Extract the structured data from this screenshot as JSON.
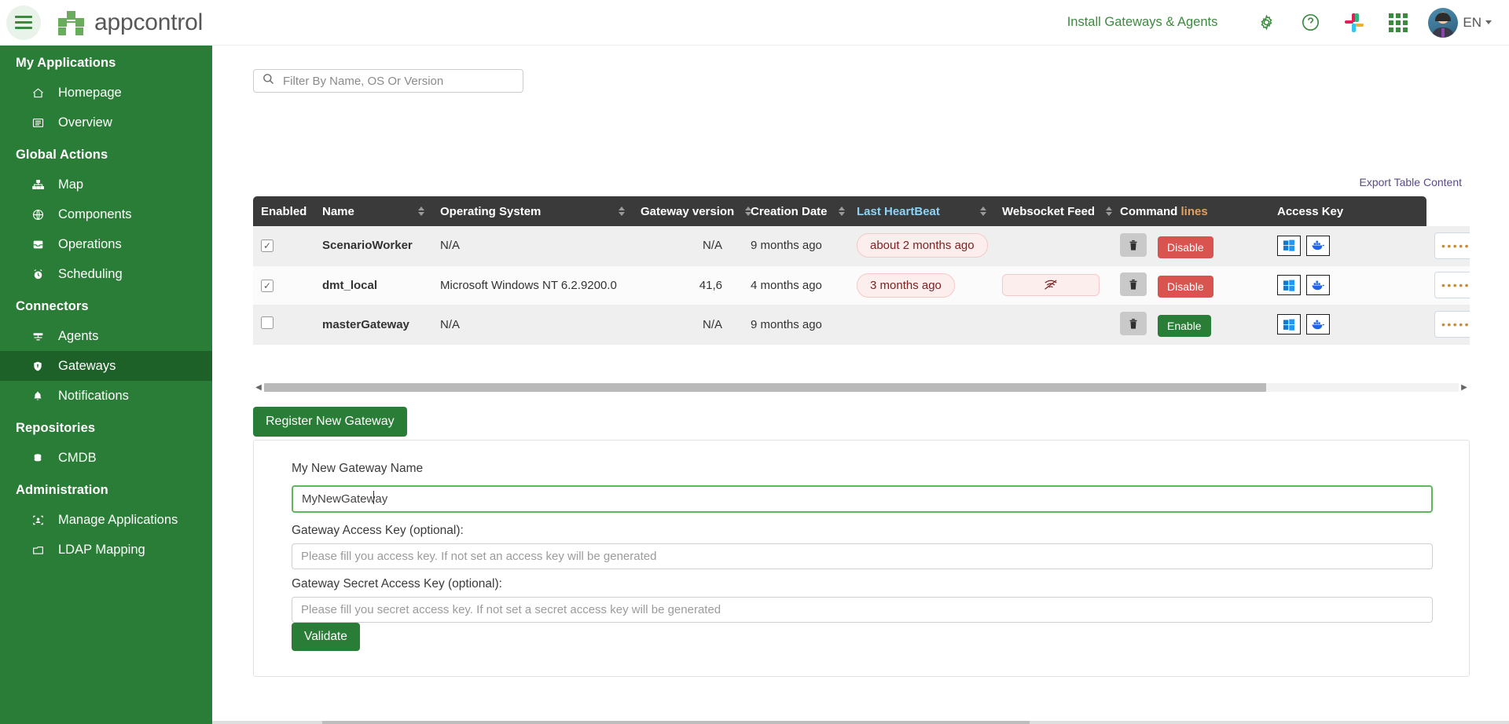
{
  "header": {
    "menu_icon": "hamburger-icon",
    "brand": "appcontrol",
    "install_link": "Install Gateways & Agents",
    "icons": [
      "gear-icon",
      "help-icon",
      "slack-icon",
      "apps-grid-icon"
    ],
    "language": "EN"
  },
  "sidebar": {
    "groups": [
      {
        "title": "My Applications",
        "items": [
          {
            "label": "Homepage",
            "icon": "home-icon",
            "active": false
          },
          {
            "label": "Overview",
            "icon": "list-icon",
            "active": false
          }
        ]
      },
      {
        "title": "Global Actions",
        "items": [
          {
            "label": "Map",
            "icon": "sitemap-icon",
            "active": false
          },
          {
            "label": "Components",
            "icon": "globe-icon",
            "active": false
          },
          {
            "label": "Operations",
            "icon": "tray-icon",
            "active": false
          },
          {
            "label": "Scheduling",
            "icon": "alarm-clock-icon",
            "active": false
          }
        ]
      },
      {
        "title": "Connectors",
        "items": [
          {
            "label": "Agents",
            "icon": "server-icon",
            "active": false
          },
          {
            "label": "Gateways",
            "icon": "shield-icon",
            "active": true
          },
          {
            "label": "Notifications",
            "icon": "bell-icon",
            "active": false
          }
        ]
      },
      {
        "title": "Repositories",
        "items": [
          {
            "label": "CMDB",
            "icon": "database-icon",
            "active": false
          }
        ]
      },
      {
        "title": "Administration",
        "items": [
          {
            "label": "Manage Applications",
            "icon": "user-card-icon",
            "active": false
          },
          {
            "label": "LDAP Mapping",
            "icon": "folder-icon",
            "active": false
          }
        ]
      }
    ]
  },
  "main": {
    "filter": {
      "placeholder": "Filter By Name, OS Or Version",
      "value": ""
    },
    "export_link": "Export Table Content",
    "table": {
      "columns": [
        {
          "label": "Enabled",
          "sortable": false,
          "active_sort": false
        },
        {
          "label": "Name",
          "sortable": true,
          "active_sort": false
        },
        {
          "label": "Operating System",
          "sortable": true,
          "active_sort": false
        },
        {
          "label": "Gateway version",
          "sortable": true,
          "active_sort": false
        },
        {
          "label": "Creation Date",
          "sortable": true,
          "active_sort": false
        },
        {
          "label": "Last HeartBeat",
          "sortable": true,
          "active_sort": true
        },
        {
          "label": "Websocket Feed",
          "sortable": true,
          "active_sort": false
        },
        {
          "label": "Command lines",
          "sortable": false,
          "active_sort": false
        },
        {
          "label": "Access Key",
          "sortable": false,
          "active_sort": false
        }
      ],
      "rows": [
        {
          "enabled": true,
          "name": "ScenarioWorker",
          "os": "N/A",
          "version": "N/A",
          "creation_date": "9 months ago",
          "last_heartbeat": "about 2 months ago",
          "websocket_feed": "",
          "websocket_icon": false,
          "state_button": "Disable",
          "state_kind": "disable",
          "access_key_masked": "••••••••••••"
        },
        {
          "enabled": true,
          "name": "dmt_local",
          "os": "Microsoft Windows NT 6.2.9200.0",
          "version": "41,6",
          "creation_date": "4 months ago",
          "last_heartbeat": "3 months ago",
          "websocket_feed": "",
          "websocket_icon": true,
          "state_button": "Disable",
          "state_kind": "disable",
          "access_key_masked": "••••••••••••"
        },
        {
          "enabled": false,
          "name": "masterGateway",
          "os": "N/A",
          "version": "N/A",
          "creation_date": "9 months ago",
          "last_heartbeat": "",
          "websocket_feed": "",
          "websocket_icon": false,
          "state_button": "Enable",
          "state_kind": "enable",
          "access_key_masked": "••••••••••••"
        }
      ]
    },
    "register_button": "Register New Gateway",
    "form": {
      "name_label": "My New Gateway Name",
      "name_value": "MyNewGateway",
      "access_key_label": "Gateway Access Key (optional):",
      "access_key_placeholder": "Please fill you access key. If not set an access key will be generated",
      "access_key_value": "",
      "secret_key_label": "Gateway Secret Access Key (optional):",
      "secret_key_placeholder": "Please fill you secret access key. If not set a secret access key will be generated",
      "secret_key_value": "",
      "validate_button": "Validate"
    }
  },
  "colors": {
    "brand_green": "#2a7d36",
    "sidebar_active": "#1e6128",
    "danger_red": "#d9534f",
    "header_dark": "#3a3a3a",
    "link_purple": "#5a4a8a"
  }
}
